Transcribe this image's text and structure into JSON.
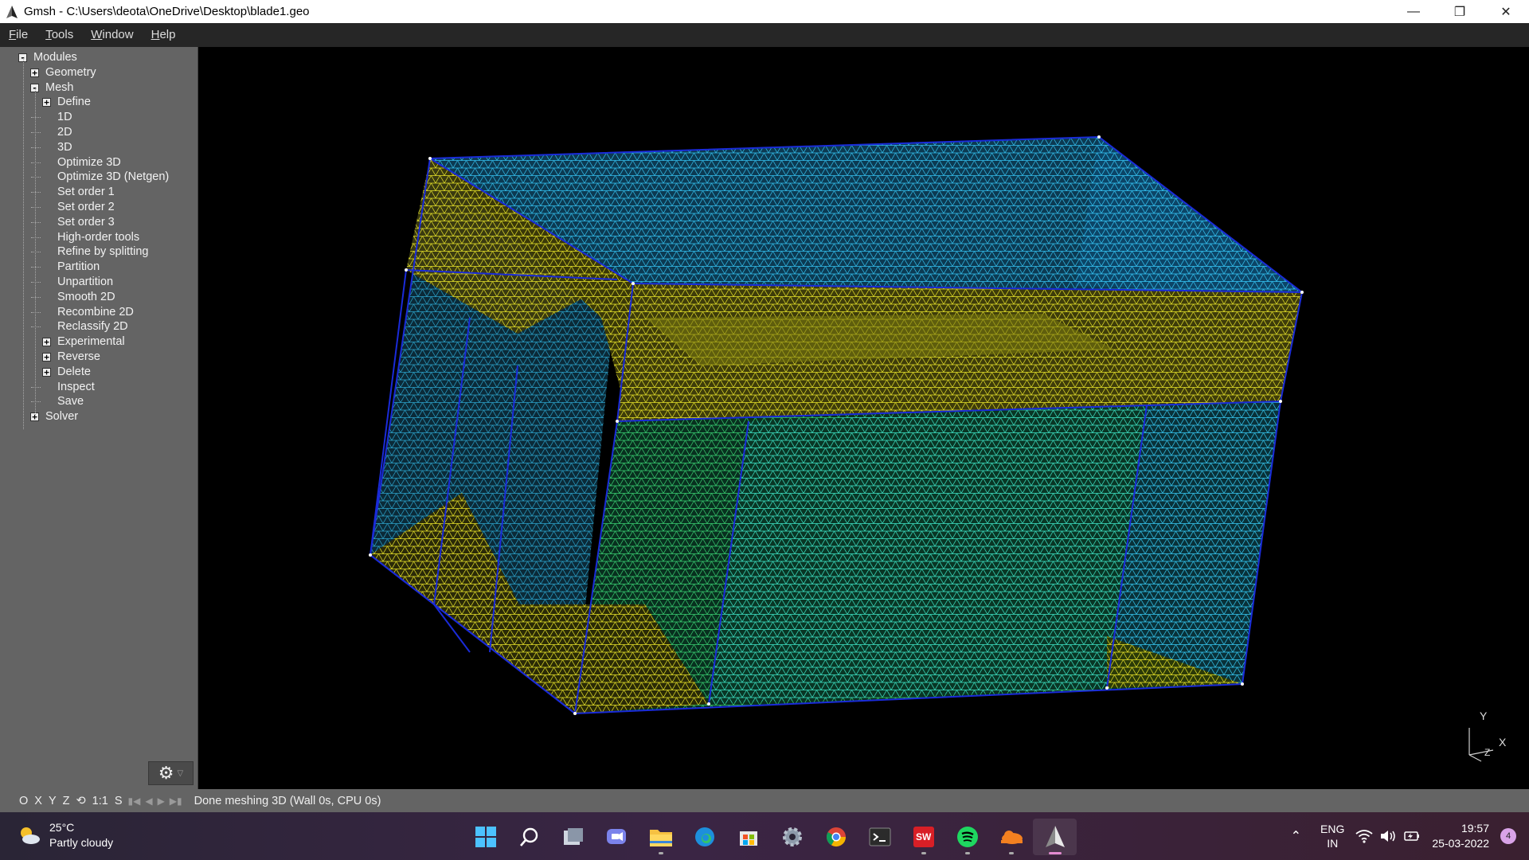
{
  "window": {
    "title": "Gmsh - C:\\Users\\deota\\OneDrive\\Desktop\\blade1.geo",
    "buttons": [
      "minimize",
      "restore",
      "close"
    ]
  },
  "menubar": {
    "items": [
      "File",
      "Tools",
      "Window",
      "Help"
    ]
  },
  "tree": {
    "nodes": [
      {
        "label": "Modules",
        "level": 0,
        "toggle": "-"
      },
      {
        "label": "Geometry",
        "level": 1,
        "toggle": "+"
      },
      {
        "label": "Mesh",
        "level": 1,
        "toggle": "-"
      },
      {
        "label": "Define",
        "level": 2,
        "toggle": "+"
      },
      {
        "label": "1D",
        "level": 2,
        "toggle": ""
      },
      {
        "label": "2D",
        "level": 2,
        "toggle": ""
      },
      {
        "label": "3D",
        "level": 2,
        "toggle": ""
      },
      {
        "label": "Optimize 3D",
        "level": 2,
        "toggle": ""
      },
      {
        "label": "Optimize 3D (Netgen)",
        "level": 2,
        "toggle": ""
      },
      {
        "label": "Set order 1",
        "level": 2,
        "toggle": ""
      },
      {
        "label": "Set order 2",
        "level": 2,
        "toggle": ""
      },
      {
        "label": "Set order 3",
        "level": 2,
        "toggle": ""
      },
      {
        "label": "High-order tools",
        "level": 2,
        "toggle": ""
      },
      {
        "label": "Refine by splitting",
        "level": 2,
        "toggle": ""
      },
      {
        "label": "Partition",
        "level": 2,
        "toggle": ""
      },
      {
        "label": "Unpartition",
        "level": 2,
        "toggle": ""
      },
      {
        "label": "Smooth 2D",
        "level": 2,
        "toggle": ""
      },
      {
        "label": "Recombine 2D",
        "level": 2,
        "toggle": ""
      },
      {
        "label": "Reclassify 2D",
        "level": 2,
        "toggle": ""
      },
      {
        "label": "Experimental",
        "level": 2,
        "toggle": "+"
      },
      {
        "label": "Reverse",
        "level": 2,
        "toggle": "+"
      },
      {
        "label": "Delete",
        "level": 2,
        "toggle": "+"
      },
      {
        "label": "Inspect",
        "level": 2,
        "toggle": ""
      },
      {
        "label": "Save",
        "level": 2,
        "toggle": ""
      },
      {
        "label": "Solver",
        "level": 1,
        "toggle": "+"
      }
    ]
  },
  "statusbar": {
    "buttons": [
      "O",
      "X",
      "Y",
      "Z",
      "⟲",
      "1:1",
      "S"
    ],
    "message": "Done meshing 3D (Wall 0s, CPU 0s)"
  },
  "axes": {
    "y": "Y",
    "x": "X",
    "z": "Z"
  },
  "taskbar": {
    "weather_temp": "25°C",
    "weather_text": "Partly cloudy",
    "apps": [
      "windows-start",
      "search",
      "task-view",
      "teams-chat",
      "file-explorer",
      "edge",
      "ms-store",
      "settings",
      "chrome",
      "terminal",
      "solidworks",
      "spotify",
      "cloudflare-warp",
      "gmsh"
    ],
    "lang_1": "ENG",
    "lang_2": "IN",
    "time": "19:57",
    "date": "25-03-2022",
    "notifications": "4"
  },
  "colors": {
    "mesh_yellow": "#d8d820",
    "mesh_cyan": "#29b6e6",
    "mesh_green": "#2dd66e",
    "edge_blue": "#1a2bd8"
  }
}
